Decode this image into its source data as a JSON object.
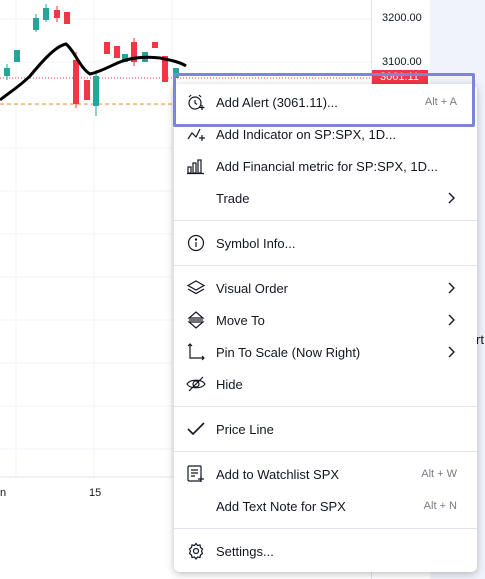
{
  "price_axis": {
    "ticks": [
      "3200.00",
      "3100.00"
    ],
    "badge": "3061.11"
  },
  "time_axis": {
    "ticks": [
      "n",
      "15"
    ]
  },
  "right_panel_fragment": "rt",
  "colors": {
    "up": "#26a69a",
    "down": "#f23645",
    "focus": "#7e84d6",
    "ma": "#000000"
  },
  "menu": {
    "items": [
      {
        "icon": "alarm-plus-icon",
        "label": "Add Alert (3061.11)...",
        "shortcut": "Alt + A"
      },
      {
        "icon": "indicator-plus-icon",
        "label": "Add Indicator on SP:SPX, 1D...",
        "shortcut": ""
      },
      {
        "icon": "bar-chart-icon",
        "label": "Add Financial metric for SP:SPX, 1D...",
        "shortcut": ""
      },
      {
        "icon": "",
        "label": "Trade",
        "shortcut": ""
      },
      {
        "icon": "info-icon",
        "label": "Symbol Info...",
        "shortcut": ""
      },
      {
        "icon": "layers-icon",
        "label": "Visual Order",
        "shortcut": ""
      },
      {
        "icon": "move-arrows-icon",
        "label": "Move To",
        "shortcut": ""
      },
      {
        "icon": "pin-scale-icon",
        "label": "Pin To Scale (Now Right)",
        "shortcut": ""
      },
      {
        "icon": "hide-eye-icon",
        "label": "Hide",
        "shortcut": ""
      },
      {
        "icon": "checkmark-icon",
        "label": "Price Line",
        "shortcut": ""
      },
      {
        "icon": "watchlist-add-icon",
        "label": "Add to Watchlist SPX",
        "shortcut": "Alt + W"
      },
      {
        "icon": "",
        "label": "Add Text Note for SPX",
        "shortcut": "Alt + N"
      },
      {
        "icon": "gear-icon",
        "label": "Settings...",
        "shortcut": ""
      }
    ]
  }
}
